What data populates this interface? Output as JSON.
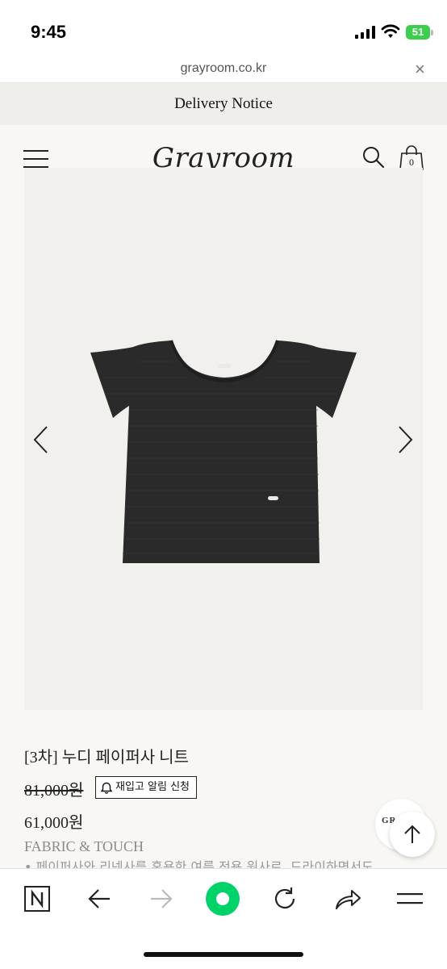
{
  "status_bar": {
    "time": "9:45",
    "battery": "51"
  },
  "url_bar": {
    "url": "grayroom.co.kr",
    "close_glyph": "×"
  },
  "notice": {
    "text": "Delivery Notice"
  },
  "header": {
    "logo": "Grayroom",
    "cart_count": "0"
  },
  "product": {
    "name": "[3차] 누디 페이퍼사 니트",
    "original_price": "81,000원",
    "restock_label": "재입고 알림 신청",
    "sale_price": "61,000원",
    "section_title": "FABRIC & TOUCH",
    "description": "• 페이퍼사와 리넨사를 혼용한 여름 전용 원사로, 드라이하면서도"
  },
  "floating": {
    "brand_text": "GR"
  },
  "icons": [
    "menu-icon",
    "search-icon",
    "shopping-bag-icon",
    "chevron-left-icon",
    "chevron-right-icon",
    "bell-icon",
    "arrow-up-icon",
    "naver-icon",
    "back-arrow-icon",
    "forward-arrow-icon",
    "green-dot-icon",
    "reload-icon",
    "share-icon",
    "hamburger-icon"
  ],
  "colors": {
    "accent_green": "#00d26a",
    "battery_green": "#3ccf4e"
  }
}
